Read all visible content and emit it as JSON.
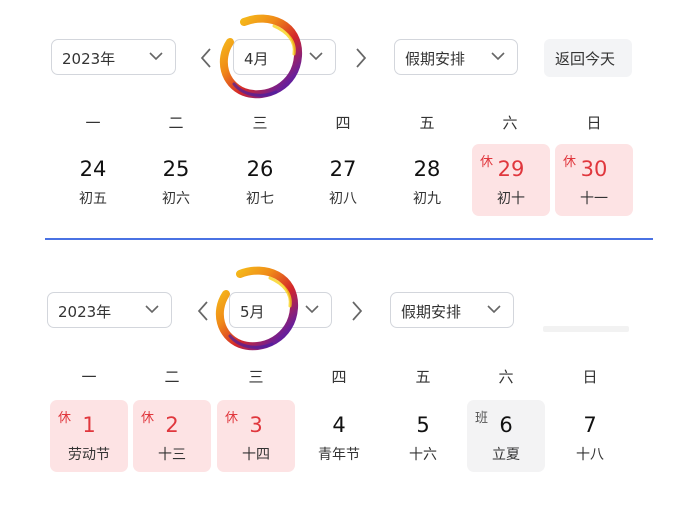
{
  "panels": [
    {
      "year": "2023年",
      "month": "4月",
      "holiday_select": "假期安排",
      "today_button": "返回今天",
      "weekdays": [
        "一",
        "二",
        "三",
        "四",
        "五",
        "六",
        "日"
      ],
      "days": [
        {
          "num": "24",
          "lunar": "初五",
          "tag": "",
          "type": "normal"
        },
        {
          "num": "25",
          "lunar": "初六",
          "tag": "",
          "type": "normal"
        },
        {
          "num": "26",
          "lunar": "初七",
          "tag": "",
          "type": "normal"
        },
        {
          "num": "27",
          "lunar": "初八",
          "tag": "",
          "type": "normal"
        },
        {
          "num": "28",
          "lunar": "初九",
          "tag": "",
          "type": "normal"
        },
        {
          "num": "29",
          "lunar": "初十",
          "tag": "休",
          "type": "holiday"
        },
        {
          "num": "30",
          "lunar": "十一",
          "tag": "休",
          "type": "holiday"
        }
      ]
    },
    {
      "year": "2023年",
      "month": "5月",
      "holiday_select": "假期安排",
      "weekdays": [
        "一",
        "二",
        "三",
        "四",
        "五",
        "六",
        "日"
      ],
      "days": [
        {
          "num": "1",
          "lunar": "劳动节",
          "tag": "休",
          "type": "holiday"
        },
        {
          "num": "2",
          "lunar": "十三",
          "tag": "休",
          "type": "holiday"
        },
        {
          "num": "3",
          "lunar": "十四",
          "tag": "休",
          "type": "holiday"
        },
        {
          "num": "4",
          "lunar": "青年节",
          "tag": "",
          "type": "normal"
        },
        {
          "num": "5",
          "lunar": "十六",
          "tag": "",
          "type": "normal"
        },
        {
          "num": "6",
          "lunar": "立夏",
          "tag": "班",
          "type": "workday"
        },
        {
          "num": "7",
          "lunar": "十八",
          "tag": "",
          "type": "normal"
        }
      ]
    }
  ],
  "colors": {
    "holiday_bg": "#fde3e4",
    "holiday_text": "#e0373d",
    "workday_bg": "#f3f3f4",
    "divider": "#4a72e3"
  },
  "icons": [
    "chevron-down-icon",
    "chevron-left-icon",
    "chevron-right-icon",
    "brush-ring-icon"
  ]
}
